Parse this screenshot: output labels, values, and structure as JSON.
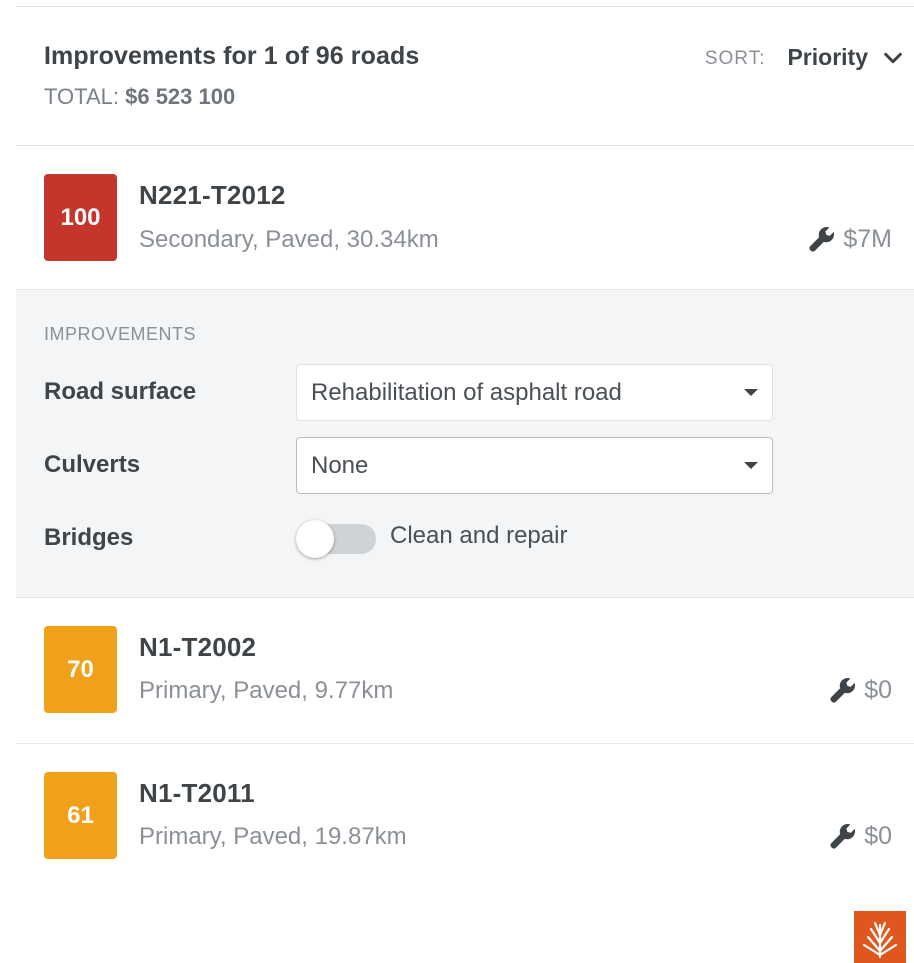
{
  "header": {
    "title": "Improvements for 1 of 96 roads",
    "total_label": "TOTAL:",
    "total_value": "$6 523 100",
    "sort_label": "SORT:",
    "sort_value": "Priority"
  },
  "roads": [
    {
      "score": "100",
      "color": "#c4352c",
      "name": "N221-T2012",
      "desc": "Secondary, Paved, 30.34km",
      "cost": "$7M"
    },
    {
      "score": "70",
      "color": "#f0a119",
      "name": "N1-T2002",
      "desc": "Primary, Paved, 9.77km",
      "cost": "$0"
    },
    {
      "score": "61",
      "color": "#f0a119",
      "name": "N1-T2011",
      "desc": "Primary, Paved, 19.87km",
      "cost": "$0"
    }
  ],
  "improvements": {
    "section_label": "IMPROVEMENTS",
    "road_surface": {
      "label": "Road surface",
      "value": "Rehabilitation of asphalt road"
    },
    "culverts": {
      "label": "Culverts",
      "value": "None"
    },
    "bridges": {
      "label": "Bridges",
      "toggle_label": "Clean and repair",
      "enabled": false
    }
  },
  "icons": {
    "sort": "chevron-down-icon",
    "cost": "wrench-icon",
    "logo": "wheat-logo-icon"
  }
}
